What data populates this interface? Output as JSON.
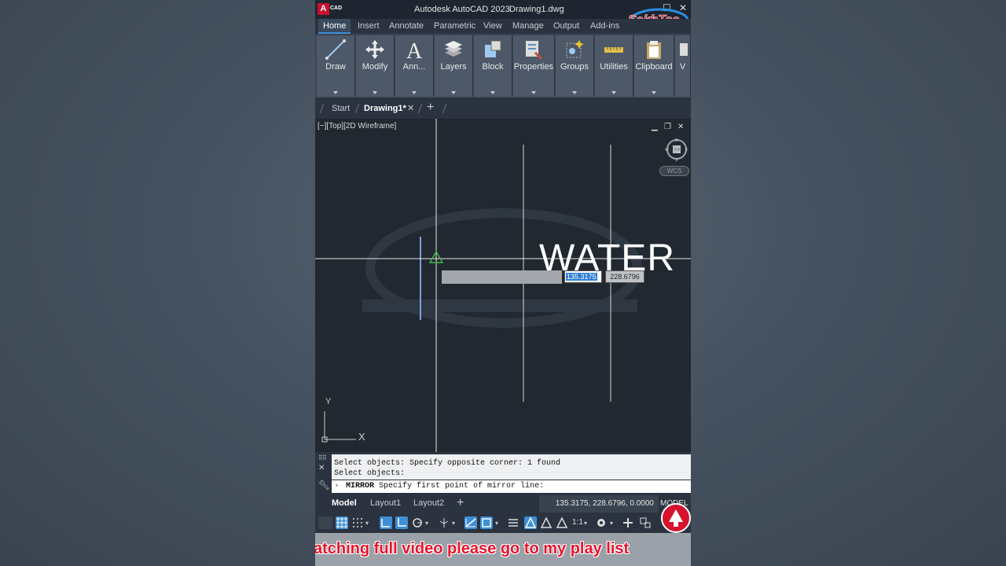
{
  "window": {
    "app_badge": "A",
    "app_badge_sub": "CAD",
    "title": "Autodesk AutoCAD 2023",
    "filename": "Drawing1.dwg",
    "watermark": "SekhTec"
  },
  "ribbon_tabs": [
    "Home",
    "Insert",
    "Annotate",
    "Parametric",
    "View",
    "Manage",
    "Output",
    "Add-ins"
  ],
  "ribbon_panels": [
    {
      "label": "Draw",
      "icon": "line-icon"
    },
    {
      "label": "Modify",
      "icon": "move-icon"
    },
    {
      "label": "Ann...",
      "icon": "text-icon"
    },
    {
      "label": "Layers",
      "icon": "layers-icon"
    },
    {
      "label": "Block",
      "icon": "block-icon"
    },
    {
      "label": "Properties",
      "icon": "properties-icon"
    },
    {
      "label": "Groups",
      "icon": "groups-icon"
    },
    {
      "label": "Utilities",
      "icon": "measure-icon"
    },
    {
      "label": "Clipboard",
      "icon": "clipboard-icon"
    },
    {
      "label": "V",
      "icon": "view-icon"
    }
  ],
  "file_tabs": {
    "start": "Start",
    "active": "Drawing1*",
    "add": "+"
  },
  "viewport": {
    "label": "[−][Top][2D Wireframe]",
    "wcs": "WCS",
    "drawing_text": "WATER",
    "dyn_input_x": "135.3175",
    "dyn_input_y": "228.6796",
    "ucs_y": "Y",
    "ucs_x": "X",
    "compass": {
      "n": "N",
      "s": "S",
      "e": "E",
      "w": "W",
      "center": "TOP"
    }
  },
  "command_line": {
    "history_1": "Select objects: Specify opposite corner: 1 found",
    "history_2": "Select objects:",
    "command": "MIRROR",
    "prompt": "Specify first point of mirror line:"
  },
  "layout_tabs": {
    "model": "Model",
    "layout1": "Layout1",
    "layout2": "Layout2",
    "add": "+"
  },
  "status": {
    "coordinates": "135.3175, 228.6796, 0.0000",
    "model_button": "MODEL",
    "scale": "1:1"
  },
  "subtitle": "atching full video please go to my play list",
  "colors": {
    "accent": "#3d8fd6",
    "brand_red": "#c8102e",
    "canvas": "#212830"
  }
}
